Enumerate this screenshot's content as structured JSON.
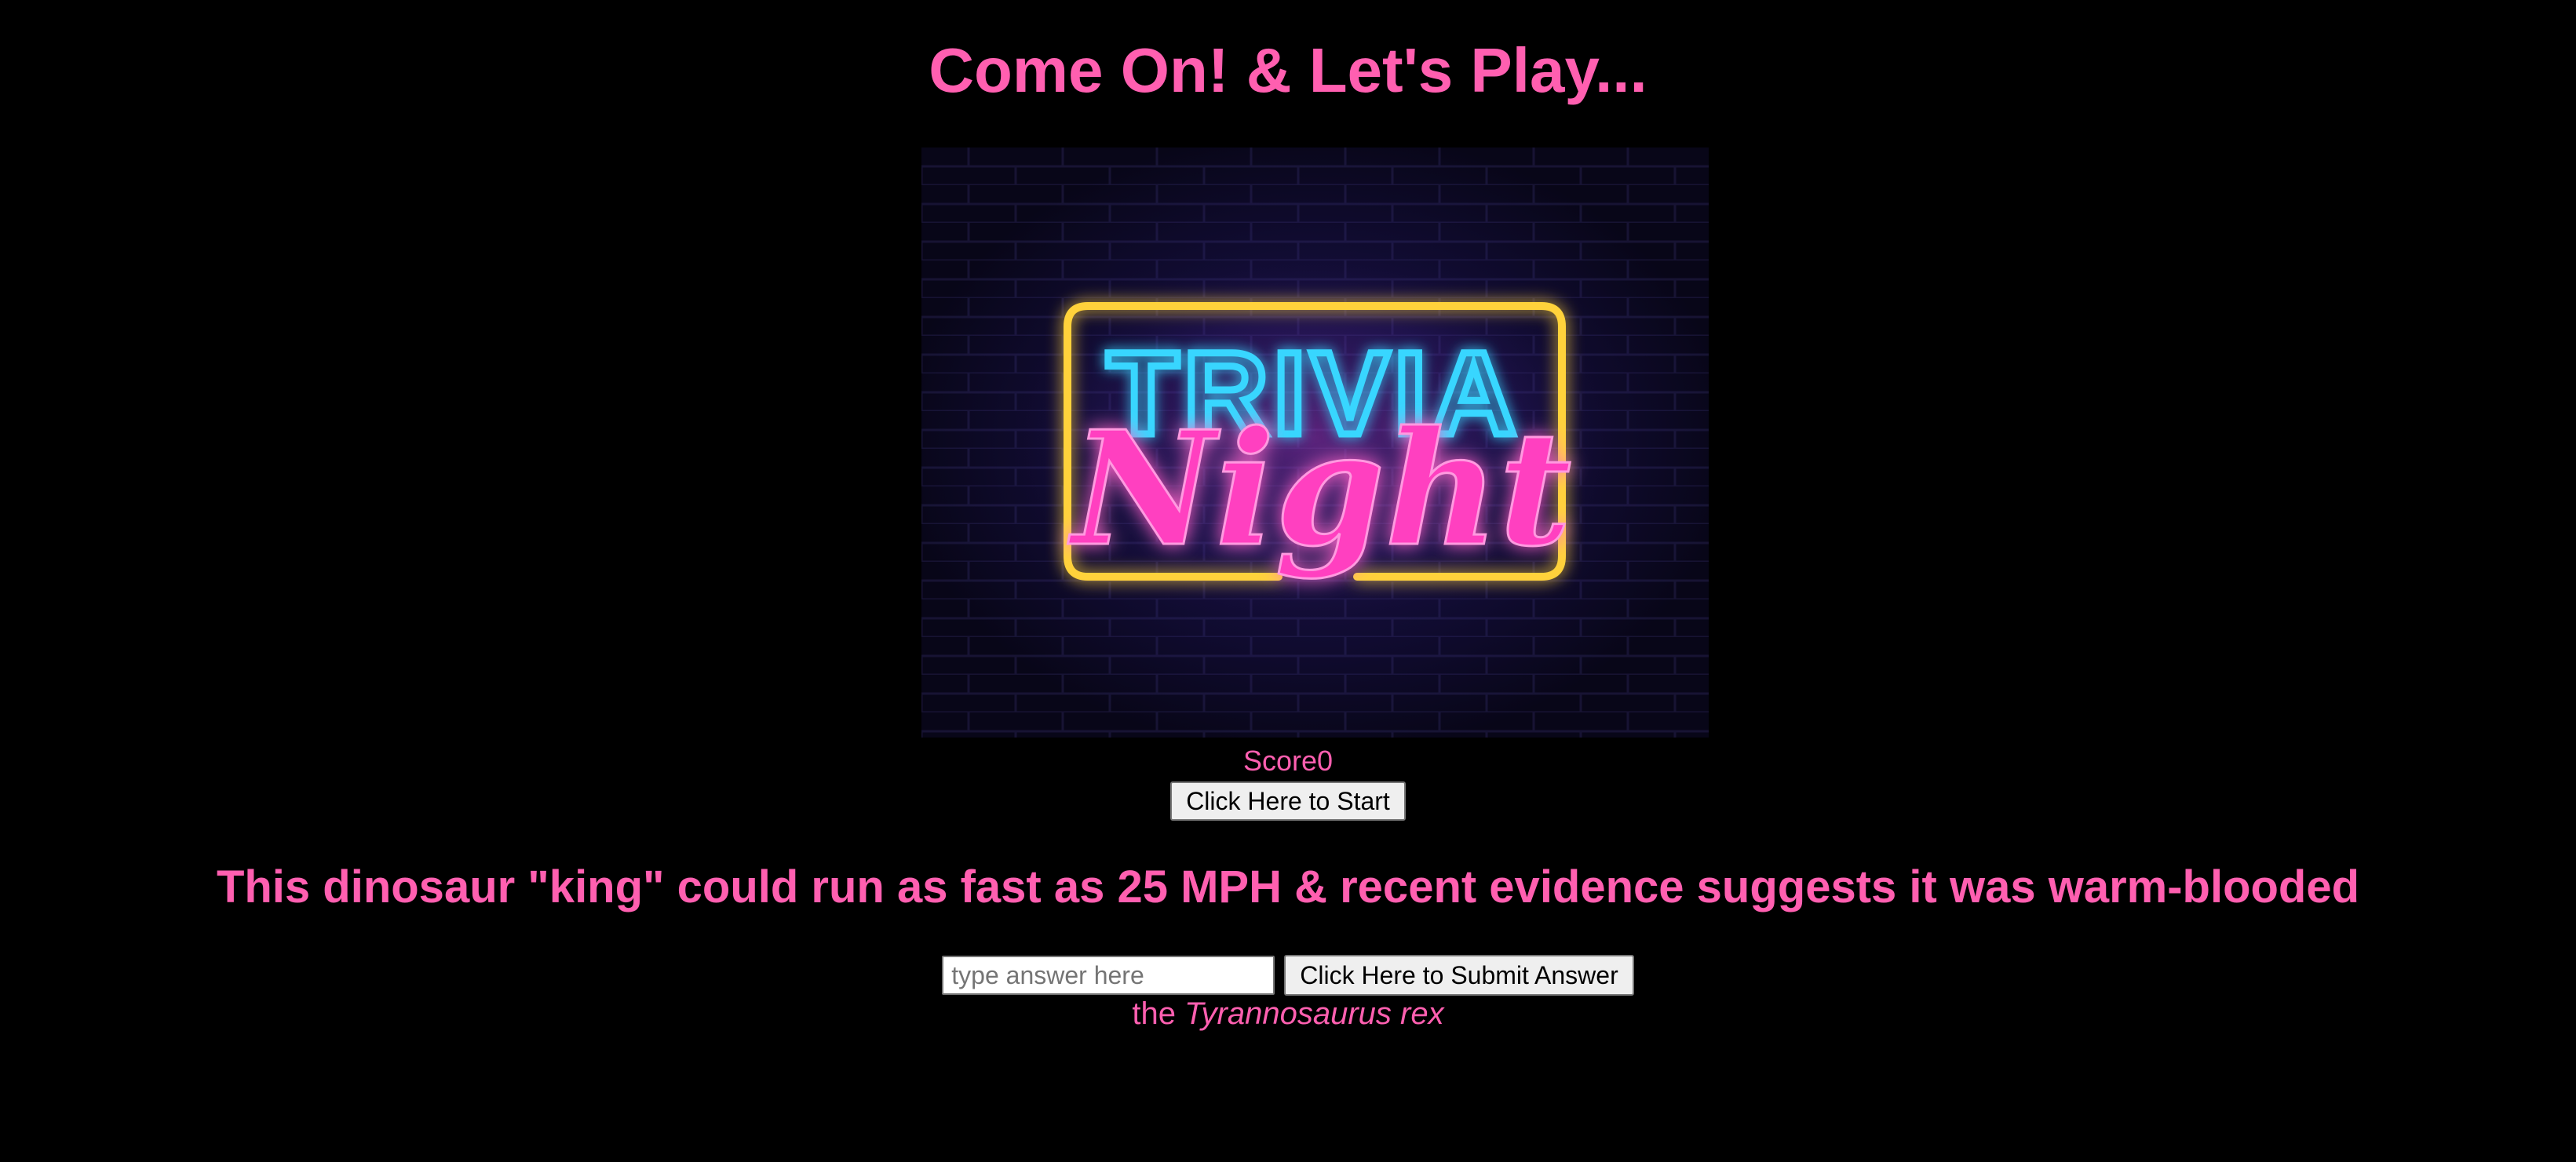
{
  "header": {
    "title": "Come On! & Let's Play..."
  },
  "hero": {
    "sign_line1": "TRIVIA",
    "sign_line2": "Night",
    "colors": {
      "frame": "#ffd23a",
      "trivia": "#39d6ff",
      "night": "#ff3fc0"
    }
  },
  "scoreboard": {
    "label": "Score",
    "value": "0"
  },
  "controls": {
    "start_label": "Click Here to Start",
    "submit_label": "Click Here to Submit Answer"
  },
  "question": {
    "text": "This dinosaur \"king\" could run as fast as 25 MPH & recent evidence suggests it was warm-blooded"
  },
  "answer": {
    "placeholder": "type answer here",
    "value": "",
    "reveal_prefix": "the ",
    "reveal_name": "Tyrannosaurus rex"
  },
  "theme": {
    "background": "#000000",
    "accent": "#ff5fb0"
  }
}
